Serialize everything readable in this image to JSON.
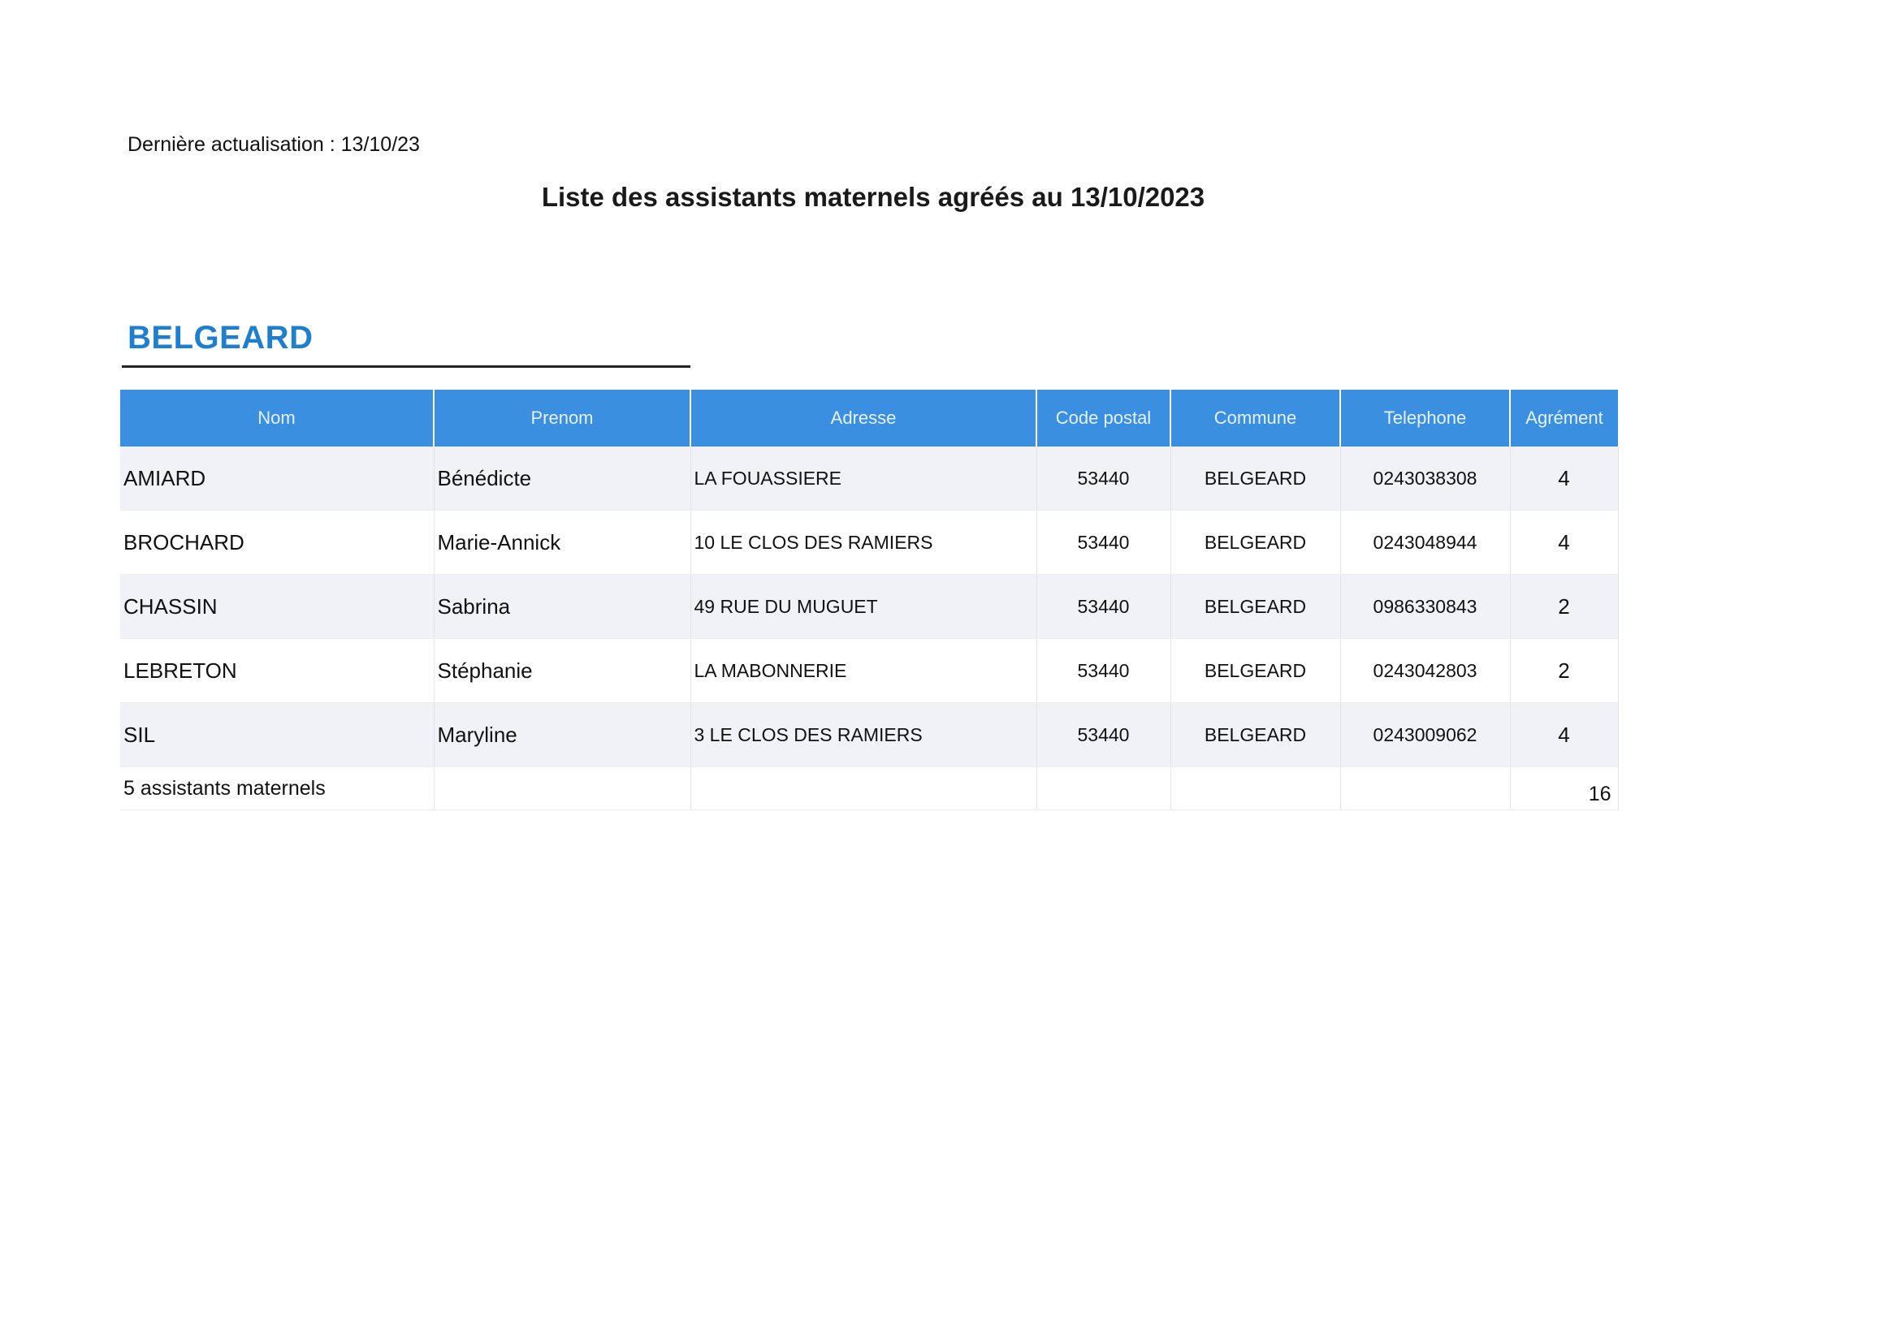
{
  "header": {
    "updated": "Dernière actualisation : 13/10/23",
    "title": "Liste des assistants maternels agréés au 13/10/2023"
  },
  "section": {
    "commune": "BELGEARD"
  },
  "table": {
    "columns": {
      "nom": "Nom",
      "prenom": "Prenom",
      "adresse": "Adresse",
      "code_postal": "Code postal",
      "commune": "Commune",
      "telephone": "Telephone",
      "agrement": "Agrément"
    },
    "rows": [
      {
        "nom": "AMIARD",
        "prenom": "Bénédicte",
        "adresse": "LA FOUASSIERE",
        "code_postal": "53440",
        "commune": "BELGEARD",
        "telephone": "0243038308",
        "agrement": "4"
      },
      {
        "nom": "BROCHARD",
        "prenom": "Marie-Annick",
        "adresse": "10  LE CLOS DES RAMIERS",
        "code_postal": "53440",
        "commune": "BELGEARD",
        "telephone": "0243048944",
        "agrement": "4"
      },
      {
        "nom": "CHASSIN",
        "prenom": "Sabrina",
        "adresse": "49  RUE DU MUGUET",
        "code_postal": "53440",
        "commune": "BELGEARD",
        "telephone": "0986330843",
        "agrement": "2"
      },
      {
        "nom": "LEBRETON",
        "prenom": "Stéphanie",
        "adresse": "LA MABONNERIE",
        "code_postal": "53440",
        "commune": "BELGEARD",
        "telephone": "0243042803",
        "agrement": "2"
      },
      {
        "nom": "SIL",
        "prenom": "Maryline",
        "adresse": "3  LE CLOS DES RAMIERS",
        "code_postal": "53440",
        "commune": "BELGEARD",
        "telephone": "0243009062",
        "agrement": "4"
      }
    ],
    "footer": {
      "count": "5 assistants maternels",
      "total_agrement": "16"
    }
  }
}
